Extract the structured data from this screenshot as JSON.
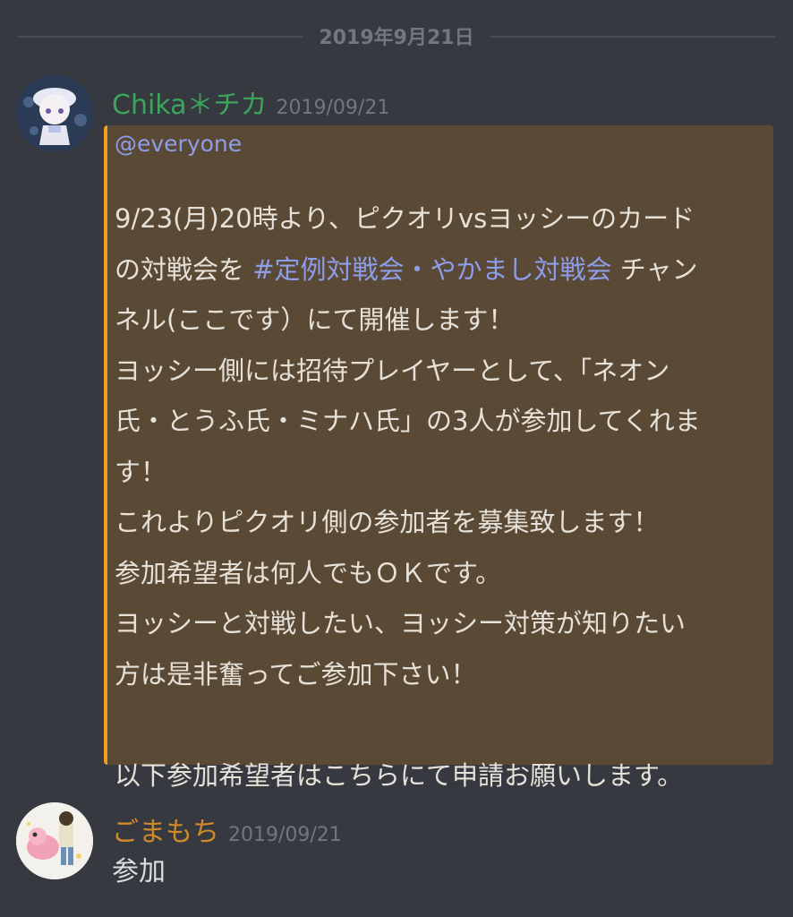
{
  "date_divider": "2019年9月21日",
  "messages": [
    {
      "username": "Chika＊チカ",
      "timestamp": "2019/09/21",
      "mention": "@everyone",
      "lines": {
        "l1": "9/23(月)20時より、ピクオリvsヨッシーのカード",
        "l2a": "の対戦会を ",
        "l2_channel": "#定例対戦会・やかまし対戦会",
        "l2b": " チャン",
        "l3": "ネル(ここです）にて開催します！",
        "l4": "ヨッシー側には招待プレイヤーとして、「ネオン",
        "l5": "氏・とうふ氏・ミナハ氏」の3人が参加してくれま",
        "l6": "す！",
        "l7": "これよりピクオリ側の参加者を募集致します！",
        "l8": "参加希望者は何人でもＯＫです。",
        "l9": "ヨッシーと対戦したい、ヨッシー対策が知りたい",
        "l10": "方は是非奮ってご参加下さい！",
        "l11": "",
        "l12": "以下参加希望者はこちらにて申請お願いします。"
      },
      "accent_color": "#f0a020",
      "highlight_bg": "#5a4a35"
    },
    {
      "username": "ごまもち",
      "timestamp": "2019/09/21",
      "text": "参加"
    }
  ]
}
